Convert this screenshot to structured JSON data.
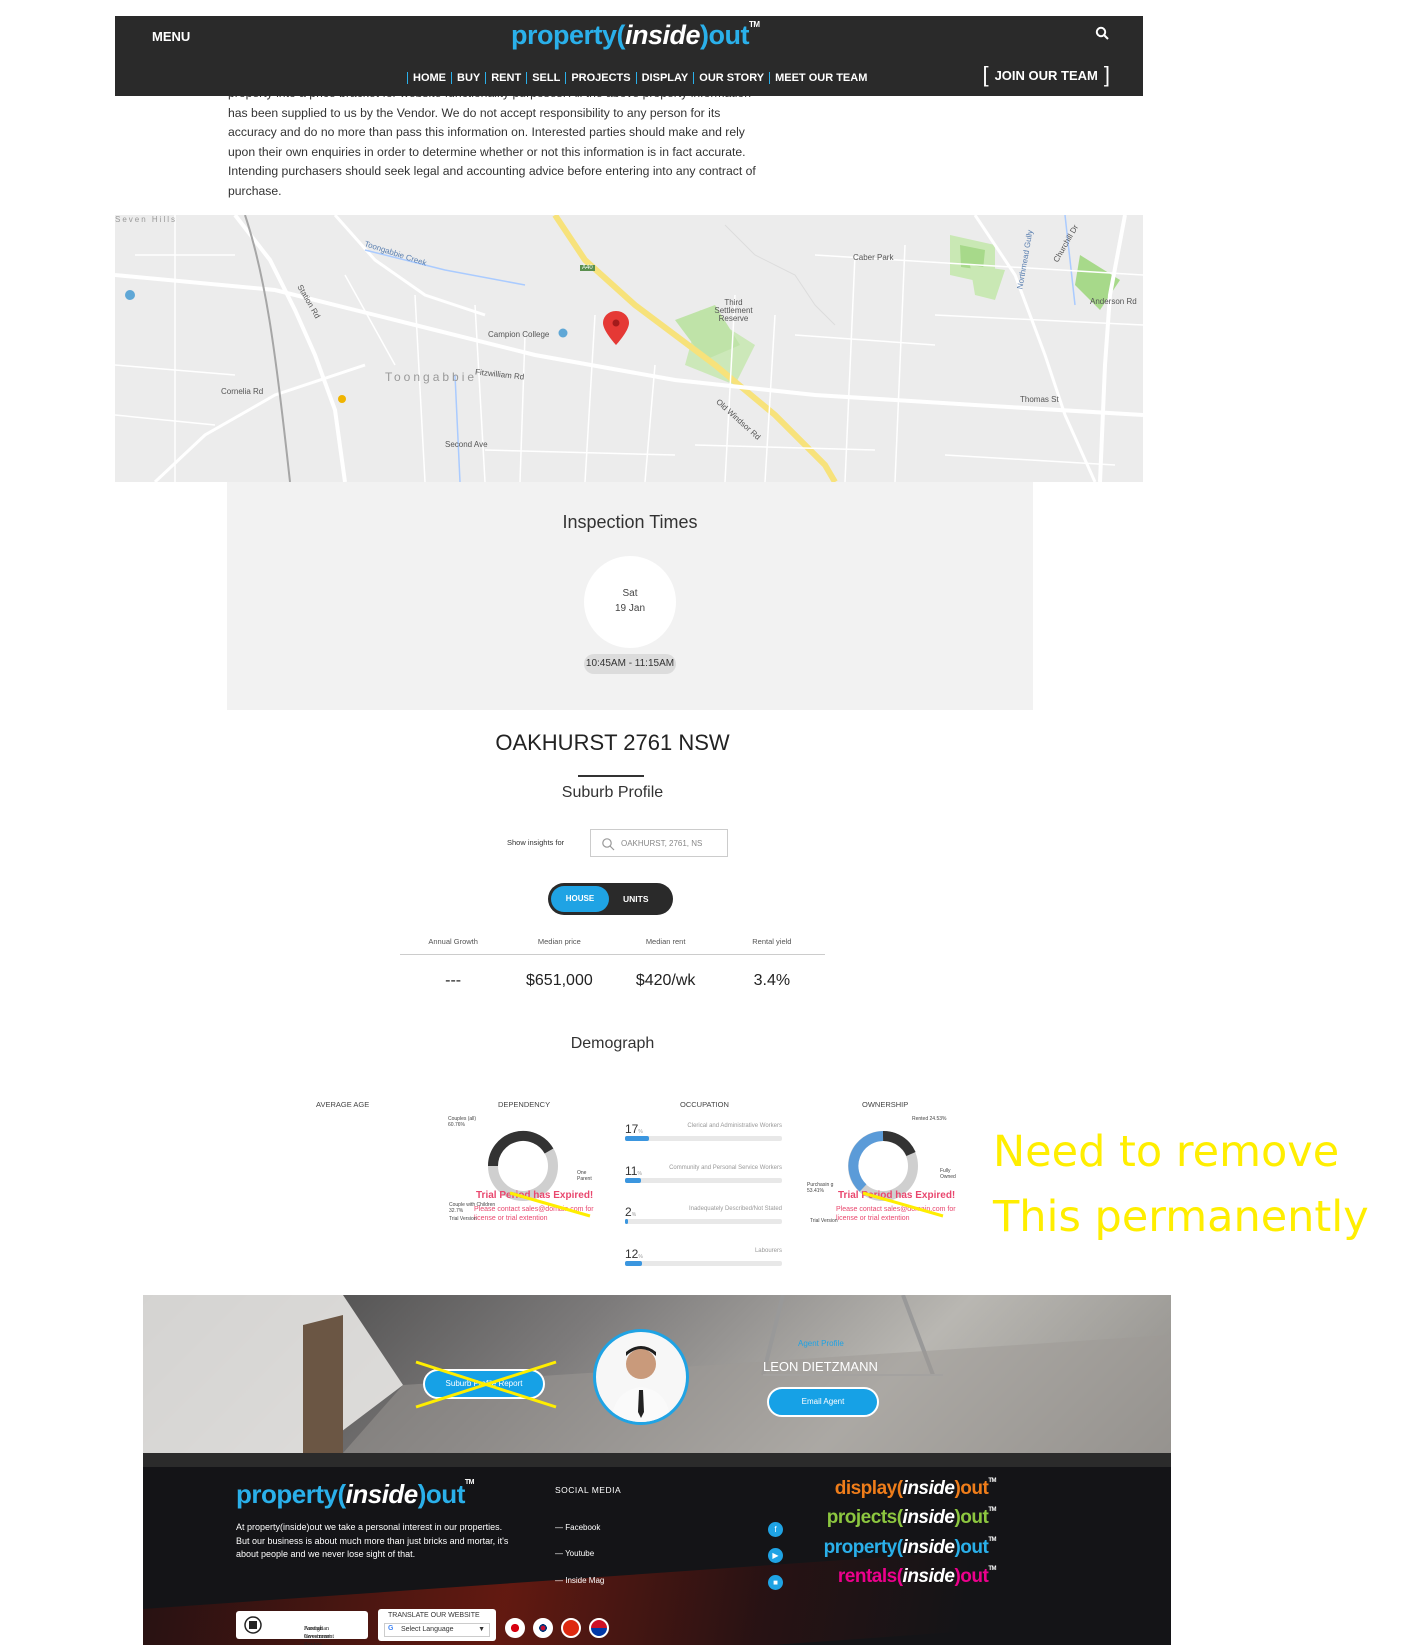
{
  "header": {
    "menu_label": "MENU",
    "logo": {
      "prefix": "property(",
      "inside": "inside",
      "suffix": ")out",
      "tm": "TM"
    },
    "nav": [
      "HOME",
      "BUY",
      "RENT",
      "SELL",
      "PROJECTS",
      "DISPLAY",
      "OUR STORY",
      "MEET OUR TEAM"
    ],
    "join_label": "JOIN OUR TEAM",
    "search_icon": "search-icon"
  },
  "disclaimer": "property into a price bracket for website functionality purposes. All the above property information has been supplied to us by the Vendor. We do not accept responsibility to any person for its accuracy and do no more than pass this information on. Interested parties should make and rely upon their own enquiries in order to determine whether or not this information is in fact accurate. Intending purchasers should seek legal and accounting advice before entering into any contract of purchase.",
  "map": {
    "labels": [
      "Toongabbie Creek",
      "Caber Park",
      "Third Settlement Reserve",
      "Campion College",
      "Toongabbie",
      "Fitzwilliam Rd",
      "Old Windsor Rd",
      "Cornelia Rd",
      "Station Rd",
      "Northmead Gully",
      "Churchill Dr",
      "Seven Hills",
      "Anderson Rd",
      "Thomas St",
      "Second Ave",
      "A40"
    ]
  },
  "inspection": {
    "title": "Inspection Times",
    "day": "Sat",
    "date": "19 Jan",
    "time": "10:45AM - 11:15AM"
  },
  "suburb": {
    "title": "OAKHURST 2761 NSW",
    "subtitle": "Suburb Profile",
    "insights_label": "Show insights for",
    "insights_value": "OAKHURST, 2761, NS",
    "toggle": {
      "house": "HOUSE",
      "units": "UNITS"
    },
    "stats": {
      "headers": [
        "Annual Growth",
        "Median price",
        "Median rent",
        "Rental yield"
      ],
      "values": [
        "---",
        "$651,000",
        "$420/wk",
        "3.4%"
      ]
    }
  },
  "demograph": {
    "title": "Demograph",
    "average_age_title": "AVERAGE AGE",
    "dependency_title": "DEPENDENCY",
    "occupation_title": "OCCUPATION",
    "ownership_title": "OWNERSHIP",
    "dependency_labels": {
      "couples": "Couples (all) 60.76%",
      "one_parent": "One Parent",
      "couple_children": "Couple with Children 32.7%"
    },
    "ownership_labels": {
      "rented": "Rented 24.53%",
      "fully_owned": "Fully Owned",
      "purchasing": "Purchasin g 53.41%"
    },
    "trial_text": "Trial Period has Expired!",
    "trial_sub": "Please contact sales@domain.com for license or trial extention",
    "trial_version": "Trial Version",
    "occupation": [
      {
        "num": "17",
        "unit": "%",
        "label": "Clerical and Administrative Workers",
        "pct": 17
      },
      {
        "num": "11",
        "unit": "%",
        "label": "Community and Personal Service Workers",
        "pct": 11
      },
      {
        "num": "2",
        "unit": "%",
        "label": "Inadequately Described/Not Stated",
        "pct": 2
      },
      {
        "num": "12",
        "unit": "%",
        "label": "Labourers",
        "pct": 12
      }
    ]
  },
  "note": {
    "line1": "Need to remove",
    "line2": "This permanently",
    "color": "#ffee00"
  },
  "agent": {
    "report_button": "Suburb Profile Report",
    "agent_label": "Agent Profile",
    "name": "LEON DIETZMANN",
    "email_button": "Email Agent"
  },
  "footer": {
    "logo": {
      "prefix": "property(",
      "inside": "inside",
      "suffix": ")out",
      "tm": "TM"
    },
    "about": "At property(inside)out we take a personal interest in our properties. But our business is about much more than just bricks and mortar, it's about people and we never lose sight of that.",
    "social_title": "SOCIAL MEDIA",
    "social_links": [
      "Facebook",
      "Youtube",
      "Inside Mag"
    ],
    "brands": [
      {
        "prefix": "display(",
        "inside": "inside",
        "suffix": ")out",
        "color": "#ef7d1a"
      },
      {
        "prefix": "projects(",
        "inside": "inside",
        "suffix": ")out",
        "color": "#8cc63f"
      },
      {
        "prefix": "property(",
        "inside": "inside",
        "suffix": ")out",
        "color": "#2ab0ea"
      },
      {
        "prefix": "rentals(",
        "inside": "inside",
        "suffix": ")out",
        "color": "#ec008c"
      }
    ],
    "gov_line1": "Australian Government",
    "gov_line2": "Foreign Investment Review Board",
    "translate_title": "TRANSLATE OUR WEBSITE",
    "translate_select": "Select Language"
  },
  "colors": {
    "accent": "#1fa3e4",
    "header_bg": "#2a2a2a",
    "trial_text": "#e9476e"
  }
}
